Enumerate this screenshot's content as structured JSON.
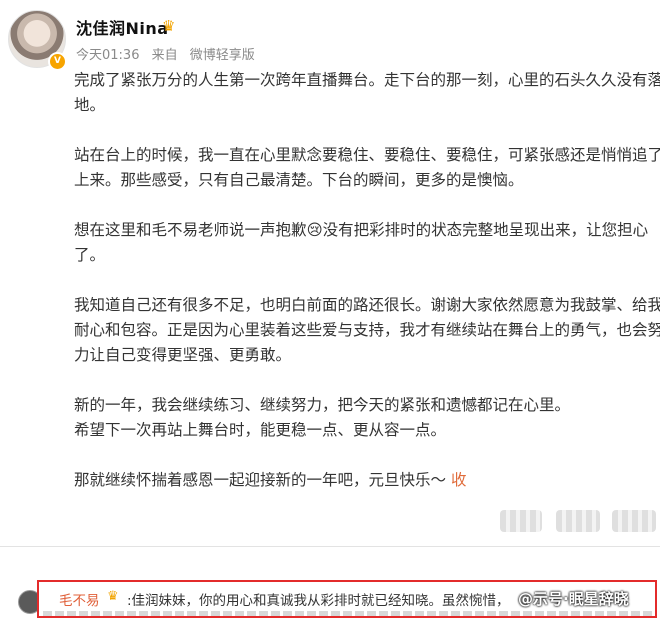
{
  "post": {
    "username": "沈佳润Nina",
    "time": "今天01:36",
    "source_prefix": "来自",
    "source": "微博轻享版",
    "lines": [
      "完成了紧张万分的人生第一次跨年直播舞台。走下台的那一刻，心里的石头久久没有落",
      "地。",
      "站在台上的时候，我一直在心里默念要稳住、要稳住、要稳住，可紧张感还是悄悄追了",
      "上来。那些感受，只有自己最清楚。下台的瞬间，更多的是懊恼。",
      "想在这里和毛不易老师说一声抱歉😢没有把彩排时的状态完整地呈现出来，让您担心",
      "了。",
      "我知道自己还有很多不足，也明白前面的路还很长。谢谢大家依然愿意为我鼓掌、给我",
      "耐心和包容。正是因为心里装着这些爱与支持，我才有继续站在舞台上的勇气，也会努",
      "力让自己变得更坚强、更勇敢。",
      "新的一年，我会继续练习、继续努力，把今天的紧张和遗憾都记在心里。",
      "希望下一次再站上舞台时，能更稳一点、更从容一点。",
      "那就继续怀揣着感恩一起迎接新的一年吧，元旦快乐～"
    ],
    "expand_label": "收"
  },
  "comment": {
    "username": "毛不易",
    "text": ":佳润妹妹，你的用心和真诚我从彩排时就已经知晓。虽然惋惜，"
  },
  "watermark": "@示号·眠星辞晓"
}
